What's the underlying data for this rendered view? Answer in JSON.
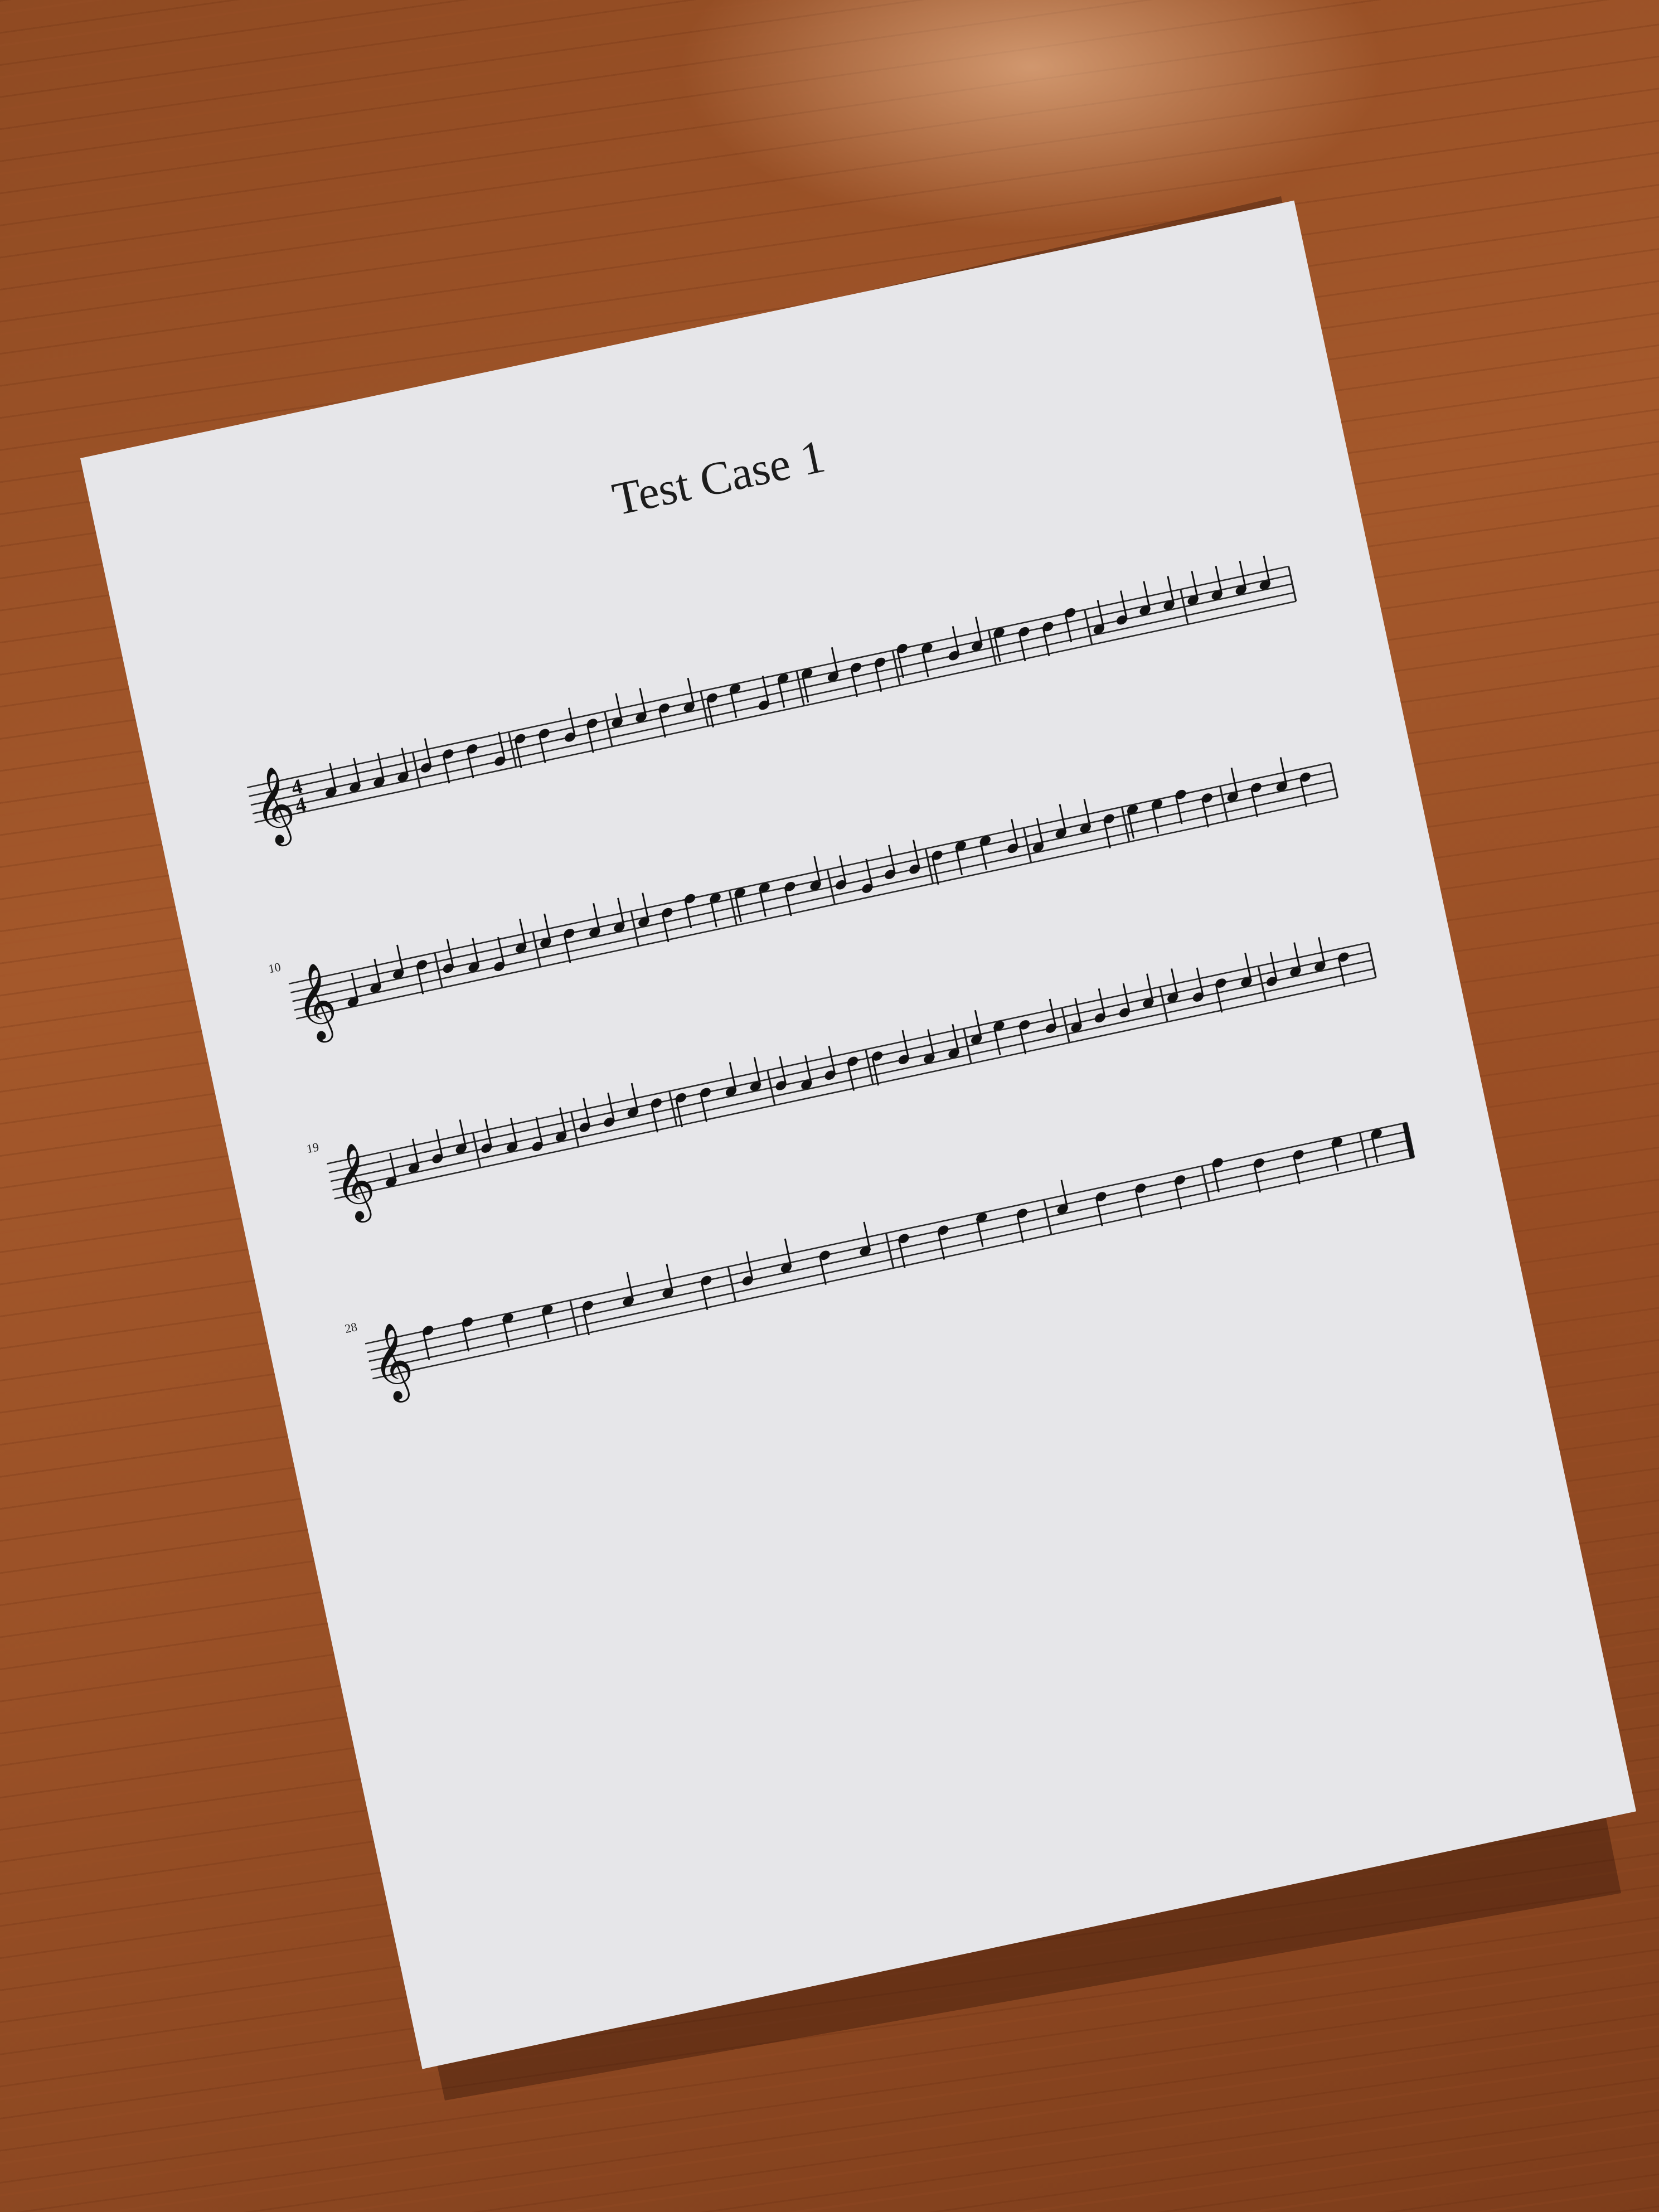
{
  "document": {
    "title": "Test Case 1",
    "time_signature": {
      "top": "4",
      "bottom": "4"
    },
    "clef_symbol": "𝄞",
    "systems": [
      {
        "measure_number": "",
        "notes": [
          3,
          3,
          3,
          3,
          4,
          6,
          6,
          2,
          6,
          6,
          4,
          6,
          5,
          5,
          6,
          5,
          6,
          7,
          2,
          7,
          7,
          5,
          6,
          6,
          8,
          7,
          4,
          5,
          7,
          6,
          6,
          8,
          3,
          4,
          5,
          5,
          5,
          5,
          5,
          5
        ]
      },
      {
        "measure_number": "10",
        "notes": [
          1,
          3,
          5,
          6,
          4,
          3,
          2,
          5,
          5,
          6,
          5,
          5,
          5,
          6,
          8,
          7,
          7,
          7,
          6,
          5,
          4,
          2,
          4,
          4,
          6,
          7,
          7,
          4,
          3,
          5,
          5,
          6,
          7,
          7,
          8,
          6,
          5,
          6,
          5,
          6
        ]
      },
      {
        "measure_number": "19",
        "notes": [
          1,
          3,
          4,
          5,
          4,
          3,
          2,
          3,
          4,
          4,
          5,
          6,
          6,
          6,
          5,
          5,
          4,
          3,
          4,
          6,
          6,
          4,
          3,
          3,
          5,
          7,
          6,
          4,
          3,
          4,
          4,
          5,
          5,
          4,
          6,
          5,
          4,
          5,
          5,
          6
        ]
      },
      {
        "measure_number": "28",
        "notes": [
          8,
          8,
          7,
          7,
          6,
          5,
          5,
          6,
          4,
          5,
          6,
          5,
          6,
          6,
          7,
          6,
          5,
          6,
          6,
          6,
          8,
          6,
          6,
          7,
          7
        ]
      }
    ],
    "final_barline": "end"
  }
}
